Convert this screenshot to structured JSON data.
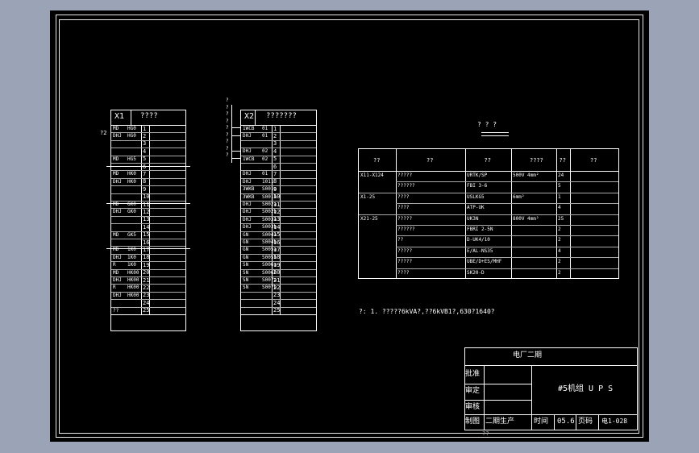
{
  "x1": {
    "title": "X1",
    "header_text": "????",
    "side_label": "?2",
    "rows": [
      {
        "a": "MD",
        "b": "HG0",
        "n": "1"
      },
      {
        "a": "DHJ",
        "b": "HG0",
        "n": "2"
      },
      {
        "a": "",
        "b": "",
        "n": "3"
      },
      {
        "a": "",
        "b": "",
        "n": "4"
      },
      {
        "a": "MD",
        "b": "HG5",
        "n": "5"
      },
      {
        "a": "",
        "b": "",
        "n": "6"
      },
      {
        "a": "MD",
        "b": "HK0",
        "n": "7"
      },
      {
        "a": "DHJ",
        "b": "HK0",
        "n": "8"
      },
      {
        "a": "",
        "b": "",
        "n": "9"
      },
      {
        "a": "",
        "b": "",
        "n": "10"
      },
      {
        "a": "MD",
        "b": "GK0",
        "n": "11"
      },
      {
        "a": "DHJ",
        "b": "GK0",
        "n": "12"
      },
      {
        "a": "",
        "b": "",
        "n": "13"
      },
      {
        "a": "",
        "b": "",
        "n": "14"
      },
      {
        "a": "MD",
        "b": "GK5",
        "n": "15"
      },
      {
        "a": "",
        "b": "",
        "n": "16"
      },
      {
        "a": "MD",
        "b": "1K0",
        "n": "17"
      },
      {
        "a": "DHJ",
        "b": "1K0",
        "n": "18"
      },
      {
        "a": "R",
        "b": "1K0",
        "n": "19"
      },
      {
        "a": "MD",
        "b": "HK00",
        "n": "20"
      },
      {
        "a": "DHJ",
        "b": "HK00",
        "n": "21"
      },
      {
        "a": "R",
        "b": "HK00",
        "n": "22"
      },
      {
        "a": "DHJ",
        "b": "HK00",
        "n": "23"
      },
      {
        "a": "",
        "b": "",
        "n": "24"
      },
      {
        "a": "??",
        "b": "",
        "n": "25"
      }
    ]
  },
  "x2": {
    "title": "X2",
    "header_text": "???????",
    "left_labels": [
      "?",
      "?",
      "?",
      "?",
      "?",
      "?",
      "?",
      "?",
      "?"
    ],
    "rows": [
      {
        "a": "1WCB",
        "b": "01",
        "n": "1"
      },
      {
        "a": "DHJ",
        "b": "01",
        "n": "2"
      },
      {
        "a": "",
        "b": "",
        "n": "3"
      },
      {
        "a": "DHJ",
        "b": "02",
        "n": "4"
      },
      {
        "a": "1WCB",
        "b": "02",
        "n": "5"
      },
      {
        "a": "",
        "b": "",
        "n": "6"
      },
      {
        "a": "DHJ",
        "b": "01",
        "n": "7"
      },
      {
        "a": "DHJ",
        "b": "1011",
        "n": "8"
      },
      {
        "a": "3WKB",
        "b": "S001a",
        "n": "9"
      },
      {
        "a": "3WKB",
        "b": "S001b",
        "n": "10"
      },
      {
        "a": "DHJ",
        "b": "S002a",
        "n": "11"
      },
      {
        "a": "DHJ",
        "b": "S002b",
        "n": "12"
      },
      {
        "a": "DHJ",
        "b": "S003a",
        "n": "13"
      },
      {
        "a": "DHJ",
        "b": "S003b",
        "n": "14"
      },
      {
        "a": "GN",
        "b": "S004a",
        "n": "15"
      },
      {
        "a": "GN",
        "b": "S004b",
        "n": "16"
      },
      {
        "a": "GN",
        "b": "S005a",
        "n": "17"
      },
      {
        "a": "GN",
        "b": "S005b",
        "n": "18"
      },
      {
        "a": "SN",
        "b": "S006a",
        "n": "19"
      },
      {
        "a": "SN",
        "b": "S006b",
        "n": "20"
      },
      {
        "a": "SN",
        "b": "S007a",
        "n": "21"
      },
      {
        "a": "SN",
        "b": "S007b",
        "n": "22"
      },
      {
        "a": "",
        "b": "",
        "n": "23"
      },
      {
        "a": "",
        "b": "",
        "n": "24"
      },
      {
        "a": "",
        "b": "",
        "n": "25"
      }
    ]
  },
  "cable": {
    "title": "? ? ?",
    "headers": [
      "??",
      "??",
      "??",
      "????",
      "??",
      "??"
    ],
    "rows": [
      {
        "c1": "X11-X124",
        "c2": "?????",
        "c3": "URTK/SP",
        "c4": "500V 4mm²",
        "c5": "24",
        "c6": ""
      },
      {
        "c1": "",
        "c2": "??????",
        "c3": "FBI 3-6",
        "c4": "",
        "c5": "5",
        "c6": ""
      },
      {
        "c1": "X1-25",
        "c2": "????",
        "c3": "USLKG5",
        "c4": "6mm²",
        "c5": "1",
        "c6": ""
      },
      {
        "c1": "",
        "c2": "????",
        "c3": "ATP-UK",
        "c4": "",
        "c5": "4",
        "c6": ""
      },
      {
        "c1": "X21-25",
        "c2": "?????",
        "c3": "UK3N",
        "c4": "800V 4mm²",
        "c5": "25",
        "c6": ""
      },
      {
        "c1": "",
        "c2": "??????",
        "c3": "FBRI 2-5N",
        "c4": "",
        "c5": "2",
        "c6": ""
      },
      {
        "c1": "",
        "c2": "??",
        "c3": "D-UK4/10",
        "c4": "",
        "c5": "2",
        "c6": ""
      },
      {
        "c1": "",
        "c2": "?????",
        "c3": "E/AL-NS35",
        "c4": "",
        "c5": "4",
        "c6": ""
      },
      {
        "c1": "",
        "c2": "?????",
        "c3": "UBE/D+ES/MHF",
        "c4": "",
        "c5": "2",
        "c6": ""
      },
      {
        "c1": "",
        "c2": "????",
        "c3": "SK20-D",
        "c4": "",
        "c5": "2",
        "c6": ""
      }
    ]
  },
  "note": "?: 1. ?????6kVA?,??6kVB1?,630?1640?",
  "title_block": {
    "plant": "电厂二期",
    "approve": "批准",
    "review": "审定",
    "check": "审核",
    "draw": "制图",
    "drawing_title": "#5机组 U P S",
    "project": "二期生产",
    "time_label": "时间",
    "time_value": "05.6",
    "page_label": "页码",
    "page_value": "电1-028",
    "below": "??"
  }
}
